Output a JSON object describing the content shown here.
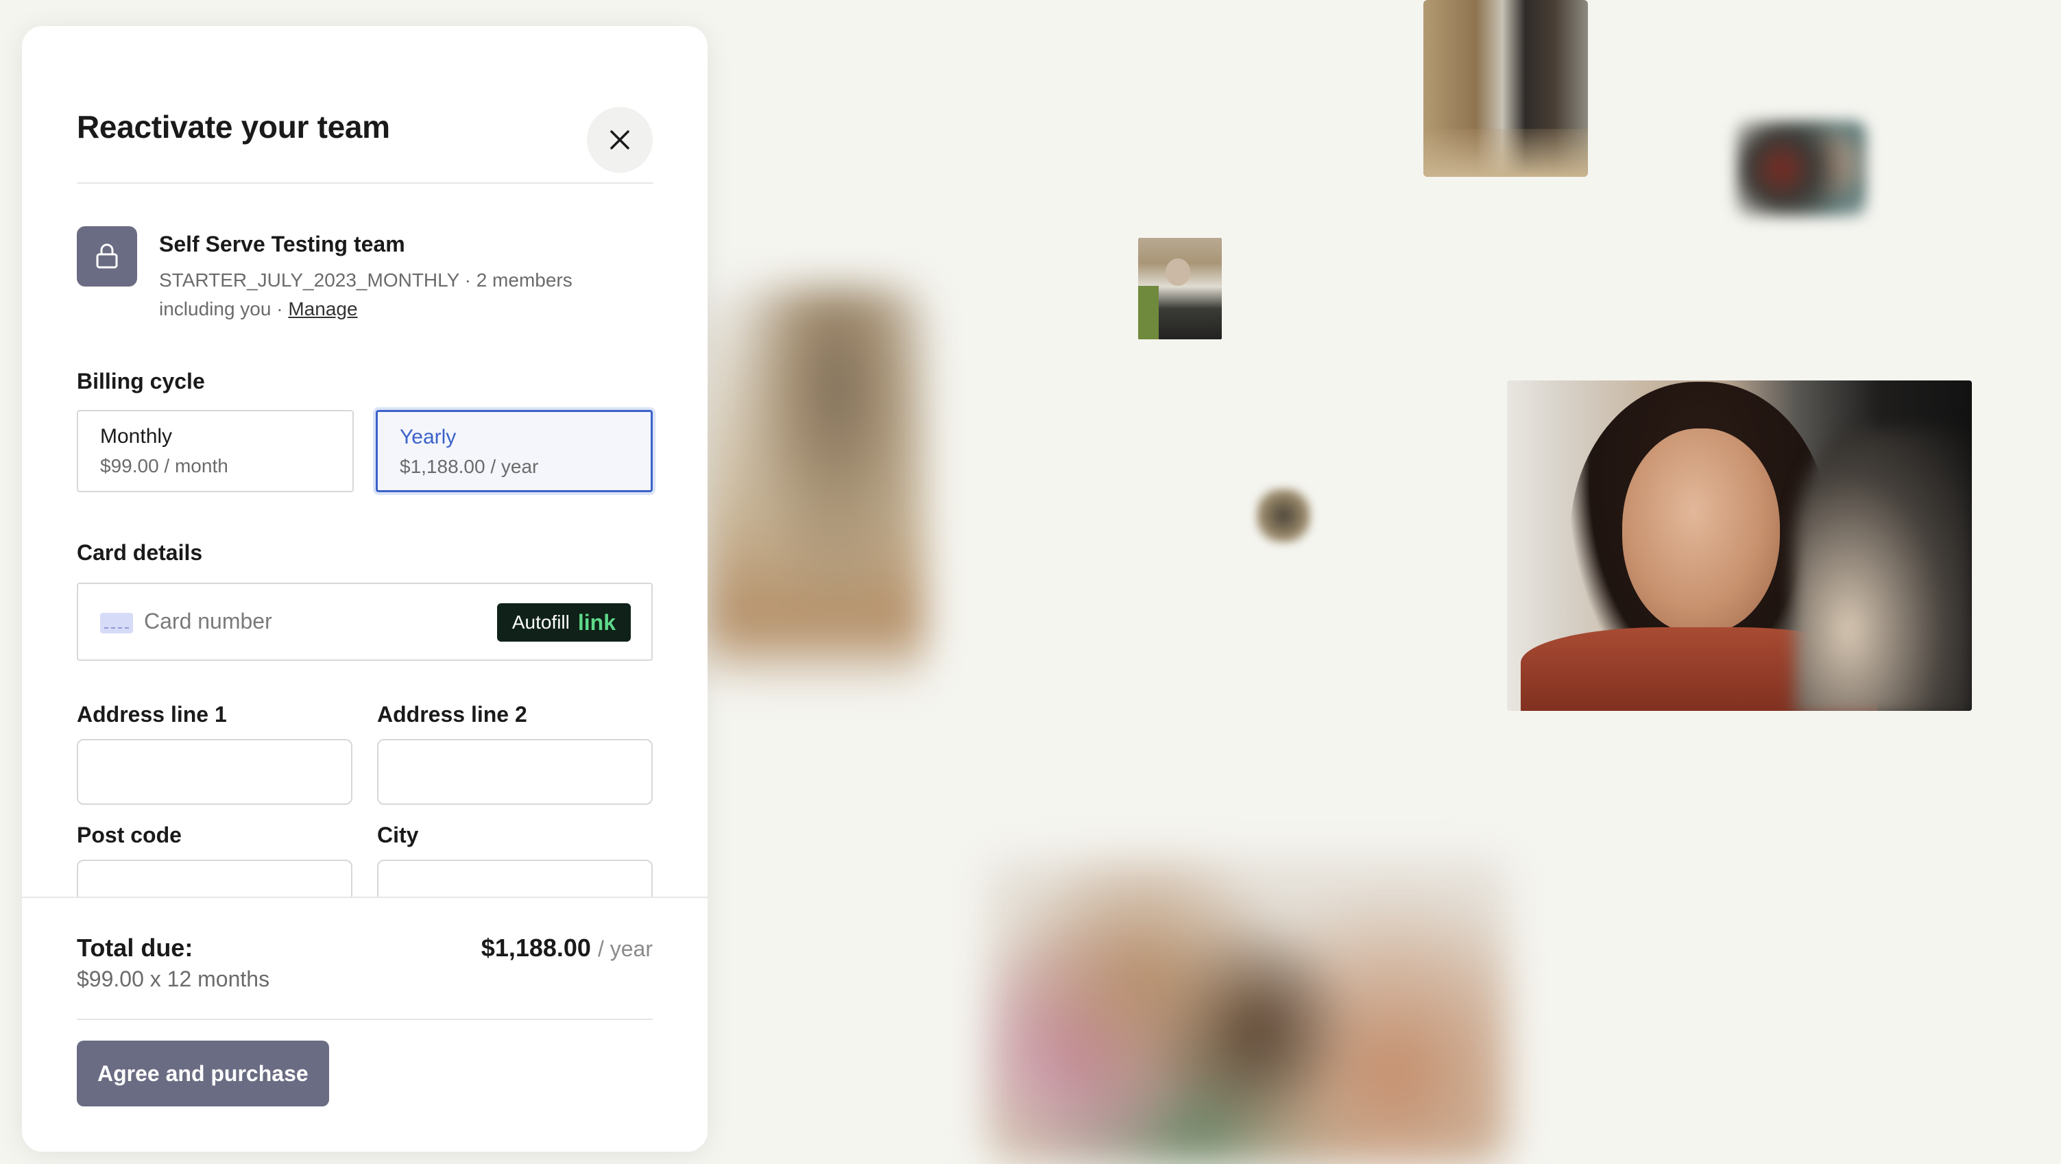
{
  "modal": {
    "title": "Reactivate your team",
    "close_icon": "close-icon"
  },
  "team": {
    "icon": "lock-icon",
    "name": "Self Serve Testing team",
    "plan": "STARTER_JULY_2023_MONTHLY",
    "members": "2 members including you",
    "manage_label": "Manage"
  },
  "billing": {
    "label": "Billing cycle",
    "selected": "Yearly",
    "options": [
      {
        "name": "Monthly",
        "price": "$99.00 / month"
      },
      {
        "name": "Yearly",
        "price": "$1,188.00 / year"
      }
    ]
  },
  "card": {
    "label": "Card details",
    "icon": "credit-card-icon",
    "placeholder": "Card number",
    "autofill_label": "Autofill",
    "autofill_brand": "link"
  },
  "address": {
    "line1_label": "Address line 1",
    "line1_value": "",
    "line2_label": "Address line 2",
    "line2_value": "",
    "postcode_label": "Post code",
    "postcode_value": "",
    "city_label": "City",
    "city_value": ""
  },
  "summary": {
    "total_label": "Total due:",
    "breakdown": "$99.00 x 12 months",
    "amount": "$1,188.00",
    "unit": "/ year",
    "purchase_label": "Agree and purchase"
  },
  "colors": {
    "accent": "#3b62c9",
    "button": "#6a6c83",
    "link_brand": "#5ed98a",
    "background": "#f5f5f0"
  }
}
